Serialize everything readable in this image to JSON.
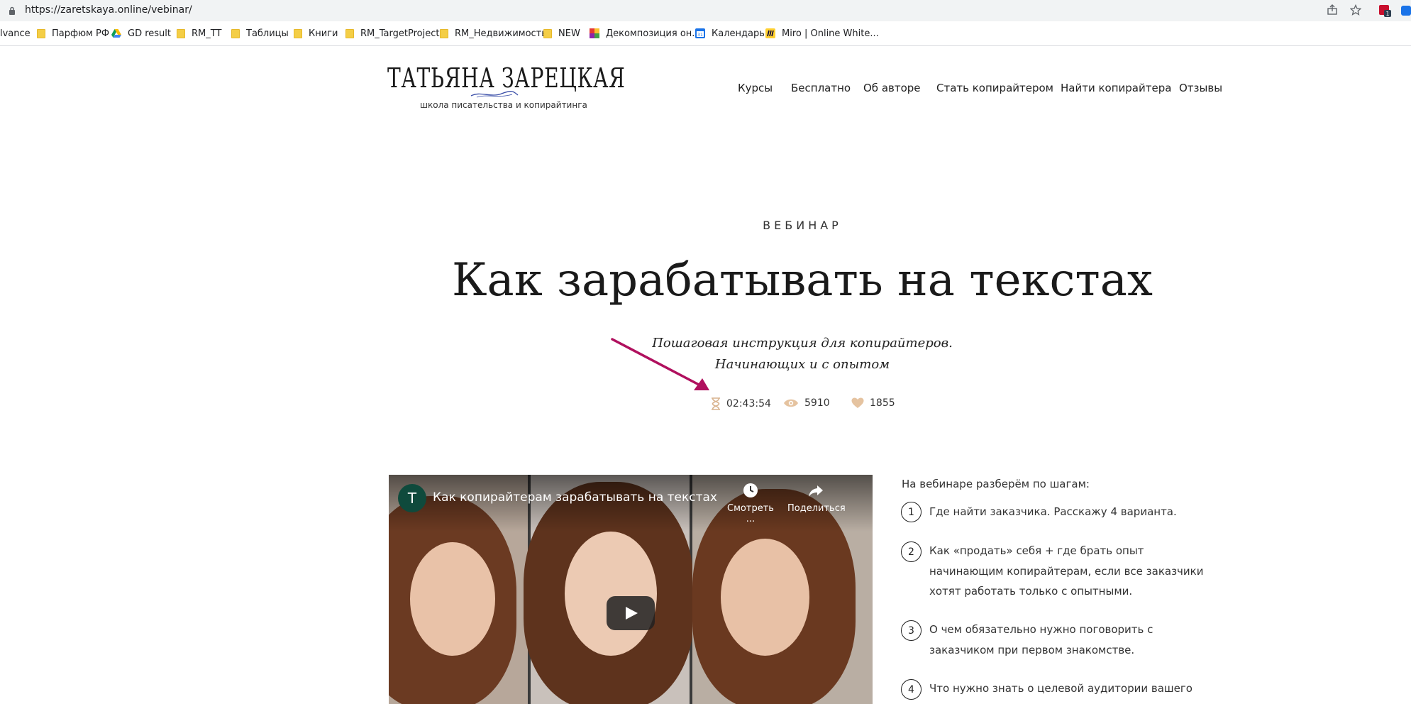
{
  "browser": {
    "url": "https://zaretskaya.online/vebinar/",
    "bookmarks": [
      {
        "label": "lvance",
        "icon": "none"
      },
      {
        "label": "Парфюм РФ",
        "icon": "folder-icon"
      },
      {
        "label": "GD result",
        "icon": "google-drive-icon"
      },
      {
        "label": "RM_TT",
        "icon": "folder-icon"
      },
      {
        "label": "Таблицы",
        "icon": "folder-icon"
      },
      {
        "label": "Книги",
        "icon": "folder-icon"
      },
      {
        "label": "RM_TargetProject",
        "icon": "folder-icon"
      },
      {
        "label": "RM_Недвижимость",
        "icon": "folder-icon"
      },
      {
        "label": "NEW",
        "icon": "folder-icon"
      },
      {
        "label": "Декомпозиция он...",
        "icon": "colorful-squares-icon"
      },
      {
        "label": "Календарь",
        "icon": "calendar-icon"
      },
      {
        "label": "Miro | Online White...",
        "icon": "miro-icon"
      }
    ],
    "extension_badge": "1"
  },
  "logo": {
    "title": "ТАТЬЯНА ЗАРЕЦКАЯ",
    "subtitle": "школа писательства и копирайтинга"
  },
  "nav": [
    "Курсы",
    "Бесплатно",
    "Об авторе",
    "Стать копирайтером",
    "Найти копирайтера",
    "Отзывы"
  ],
  "hero": {
    "eyebrow": "ВЕБИНАР",
    "title": "Как зарабатывать на текстах",
    "subtitle_line1": "Пошаговая инструкция для копирайтеров.",
    "subtitle_line2": "Начинающих и с опытом",
    "arrow_color": "#b0105e"
  },
  "stats": {
    "duration": "02:43:54",
    "views": "5910",
    "likes": "1855",
    "icon_color": "#e5c3a0"
  },
  "video": {
    "channel_initial": "T",
    "title": "Как копирайтерам зарабатывать на текстах",
    "watch_later": "Смотреть ...",
    "share": "Поделиться"
  },
  "steps": {
    "intro": "На вебинаре разберём по шагам:",
    "items": [
      {
        "num": "1",
        "lines": [
          "Где найти заказчика. Расскажу 4 варианта."
        ]
      },
      {
        "num": "2",
        "lines": [
          "Как «продать» себя + где брать опыт",
          "начинающим копирайтерам, если все заказчики",
          "хотят работать только с опытными."
        ]
      },
      {
        "num": "3",
        "lines": [
          "О чем обязательно нужно поговорить с",
          "заказчиком при первом знакомстве."
        ]
      },
      {
        "num": "4",
        "lines": [
          "Что нужно знать о целевой аудитории вашего"
        ]
      }
    ]
  }
}
